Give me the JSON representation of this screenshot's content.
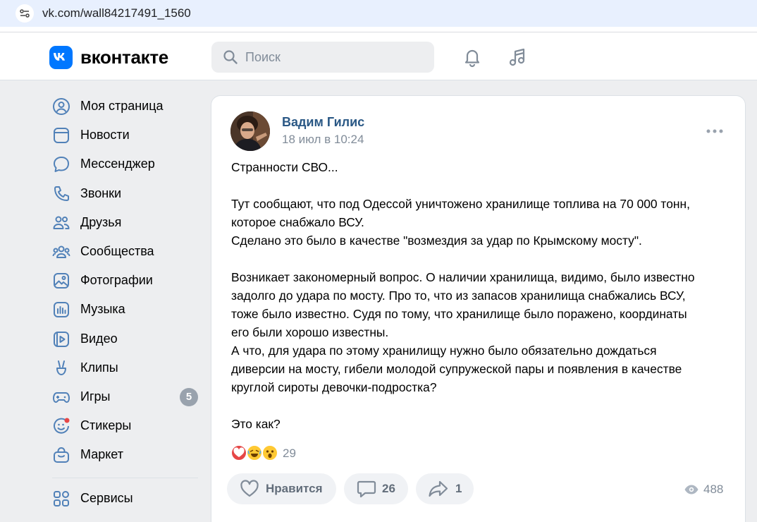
{
  "browser": {
    "url": "vk.com/wall84217491_1560"
  },
  "header": {
    "logo_text": "вконтакте",
    "search_placeholder": "Поиск"
  },
  "sidebar": {
    "items": [
      {
        "label": "Моя страница",
        "icon": "user-circle-icon"
      },
      {
        "label": "Новости",
        "icon": "news-icon"
      },
      {
        "label": "Мессенджер",
        "icon": "message-icon"
      },
      {
        "label": "Звонки",
        "icon": "phone-icon"
      },
      {
        "label": "Друзья",
        "icon": "friends-icon"
      },
      {
        "label": "Сообщества",
        "icon": "communities-icon"
      },
      {
        "label": "Фотографии",
        "icon": "photo-icon"
      },
      {
        "label": "Музыка",
        "icon": "music-icon"
      },
      {
        "label": "Видео",
        "icon": "video-icon"
      },
      {
        "label": "Клипы",
        "icon": "clips-icon"
      },
      {
        "label": "Игры",
        "icon": "games-icon",
        "badge": "5"
      },
      {
        "label": "Стикеры",
        "icon": "stickers-icon"
      },
      {
        "label": "Маркет",
        "icon": "market-icon"
      }
    ],
    "services_label": "Сервисы"
  },
  "post": {
    "author": "Вадим Гилис",
    "date": "18 июл в 10:24",
    "paragraphs": [
      "Странности СВО...",
      "Тут сообщают, что под Одессой уничтожено хранилище топлива на 70 000 тонн,\nкоторое снабжало ВСУ.\nСделано это было в качестве \"возмездия за удар по Крымскому мосту\".",
      "Возникает закономерный вопрос. О наличии хранилища, видимо, было известно\nзадолго до удара по мосту. Про то, что из запасов хранилища снабжались ВСУ,\nтоже было известно. Судя по тому, что хранилище было поражено, координаты\nего были хорошо известны.\nА что, для удара по этому хранилищу нужно было обязательно дождаться\nдиверсии на мосту, гибели молодой супружеской пары и появления в качестве\nкруглой сироты девочки-подростка?",
      "Это как?"
    ],
    "reactions_count": "29",
    "like_label": "Нравится",
    "comments_count": "26",
    "shares_count": "1",
    "views_count": "488"
  },
  "colors": {
    "accent": "#0077ff",
    "link": "#2a5885",
    "icon": "#5181b8",
    "muted": "#818c99"
  }
}
